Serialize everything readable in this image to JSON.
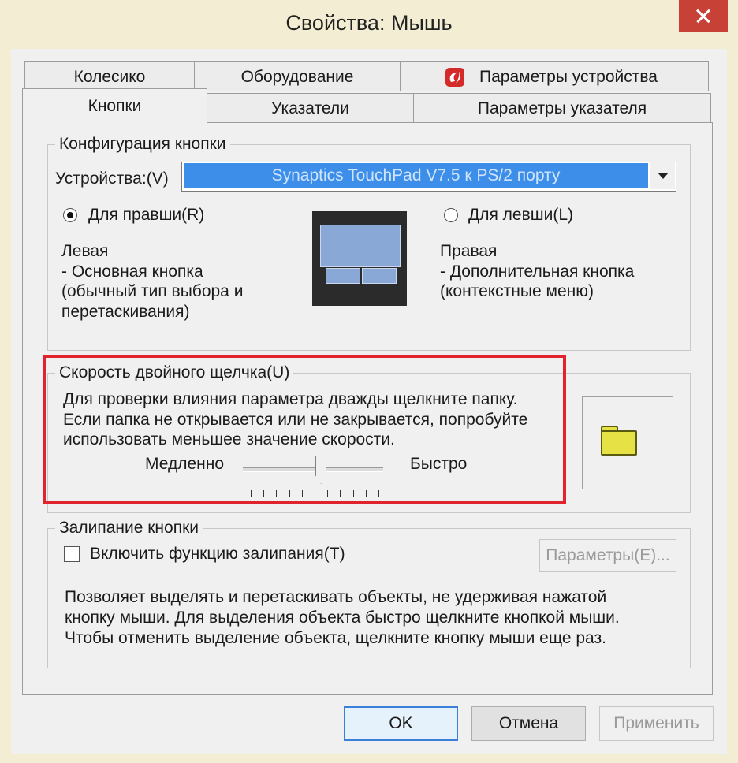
{
  "window": {
    "title": "Свойства: Мышь"
  },
  "tabs": {
    "row_back": [
      "Колесико",
      "Оборудование",
      "Параметры устройства"
    ],
    "row_front": [
      "Кнопки",
      "Указатели",
      "Параметры указателя"
    ]
  },
  "button_config": {
    "legend": "Конфигурация кнопки",
    "devices_label": "Устройства:(V)",
    "device_selected": "Synaptics TouchPad V7.5 к PS/2 порту",
    "right_handed_label": "Для правши(R)",
    "left_handed_label": "Для левши(L)",
    "right_handed_checked": true,
    "left_title": "Левая",
    "left_line1": " - Основная кнопка",
    "left_line2": "(обычный тип выбора и",
    "left_line3": "перетаскивания)",
    "right_title": "Правая",
    "right_line1": " - Дополнительная кнопка",
    "right_line2": "(контекстные меню)"
  },
  "double_click": {
    "legend": "Скорость двойного щелчка(U)",
    "line1": "Для проверки влияния параметра дважды щелкните папку.",
    "line2": "Если папка не открывается или не закрывается, попробуйте",
    "line3": "использовать меньшее значение скорости.",
    "slow_label": "Медленно",
    "fast_label": "Быстро",
    "slider_value": 0.55,
    "highlight_color": "#e0232d"
  },
  "click_lock": {
    "legend": "Залипание кнопки",
    "checkbox_label": "Включить функцию залипания(T)",
    "checked": false,
    "settings_button": "Параметры(E)...",
    "desc1": "Позволяет выделять и перетаскивать объекты, не удерживая нажатой",
    "desc2": "кнопку мыши. Для выделения объекта быстро щелкните кнопкой мыши.",
    "desc3": "Чтобы отменить выделение объекта, щелкните кнопку мыши еще раз."
  },
  "footer": {
    "ok": "OK",
    "cancel": "Отмена",
    "apply": "Применить"
  },
  "icons": {
    "tab_device_icon": "synaptics-logo-icon",
    "folder": "folder-icon",
    "close": "close-icon"
  }
}
